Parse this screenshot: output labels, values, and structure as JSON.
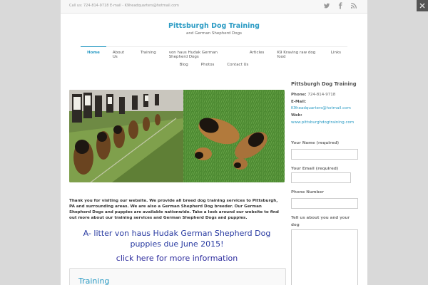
{
  "topbar": {
    "contact": "Call us: 724-814-9718 E-mail - K9headquarters@hotmail.com",
    "icons": [
      "twitter-icon",
      "facebook-icon",
      "rss-icon"
    ]
  },
  "header": {
    "title": "Pittsburgh Dog Training",
    "subtitle": "and German Shepherd Dogs"
  },
  "nav": {
    "row1": [
      {
        "label": "Home",
        "active": true
      },
      {
        "label": "About Us"
      },
      {
        "label": "Training"
      },
      {
        "label": "von haus Hudak German Shepherd Dogs"
      },
      {
        "label": "Articles"
      },
      {
        "label": "K9 Kraving raw dog food"
      },
      {
        "label": "Links"
      }
    ],
    "row2": [
      {
        "label": "Blog"
      },
      {
        "label": "Photos"
      },
      {
        "label": "Contact Us"
      }
    ]
  },
  "main": {
    "intro": "Thank you for visiting our website. We provide all breed dog training services to Pittsburgh, PA and surrounding areas.  We are also a German Shepherd Dog breeder. Our German Shepherd Dogs and puppies are available nationwide. Take a look around our website to find out more about our training services and German Shepherd Dogs and puppies.",
    "headline": "A- litter von haus Hudak German Shepherd Dog puppies due June 2015!",
    "more_link": "click here for more information",
    "training_title": "Training"
  },
  "sidebar": {
    "title": "Pittsburgh Dog Training",
    "phone_label": "Phone:",
    "phone": "724-814-9718",
    "email_label": "E-Mail:",
    "email": "K9headquarters@hotmail.com",
    "web_label": "Web:",
    "web": "www.pittsburghdogtraining.com"
  },
  "form": {
    "name_label": "Your Name (required)",
    "email_label": "Your Email (required)",
    "phone_label": "Phone Number",
    "message_label": "Tell us about you and your dog"
  },
  "colors": {
    "accent": "#2b9bc4",
    "headline": "#283aa1"
  }
}
